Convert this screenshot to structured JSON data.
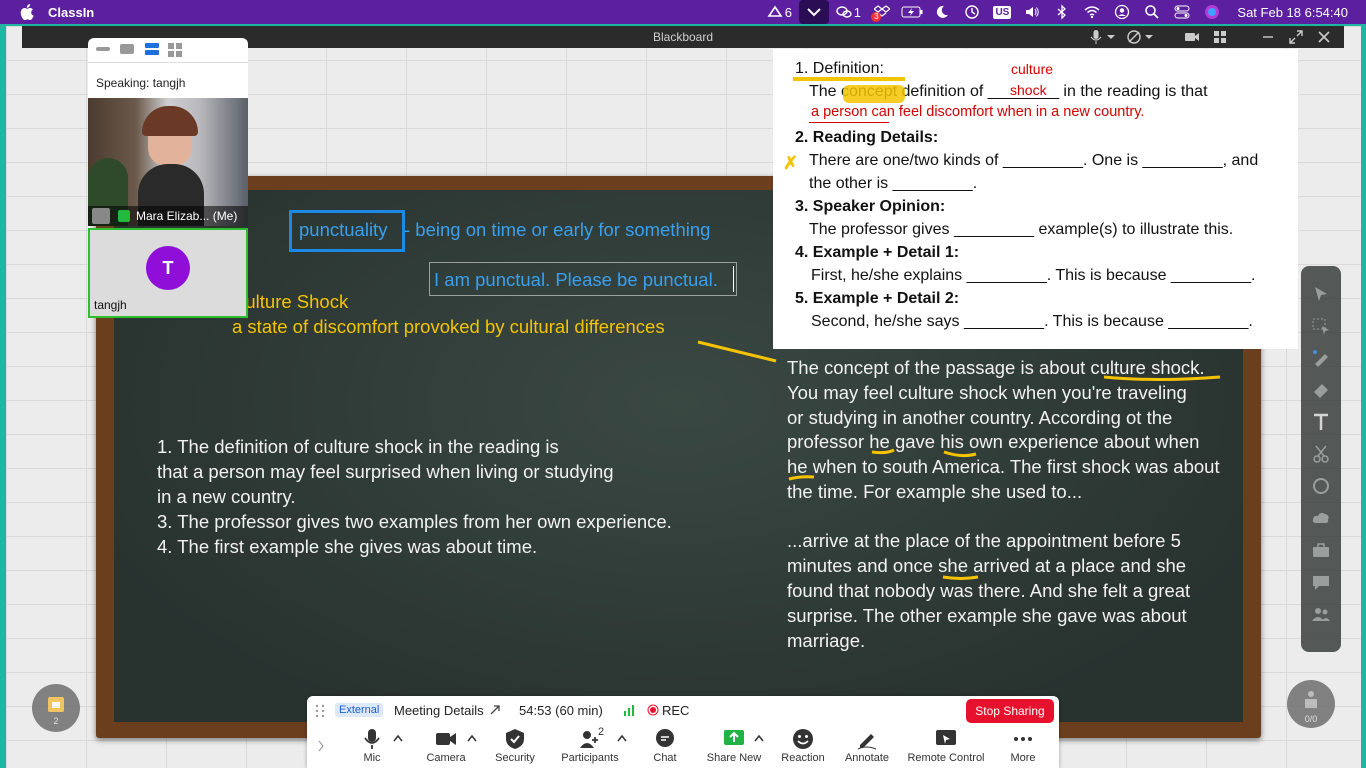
{
  "menubar": {
    "app_name": "ClassIn",
    "badge_6": "6",
    "wechat_count": "1",
    "notif_count": "3",
    "keyboard": "US",
    "datetime": "Sat Feb 18  6:54:40"
  },
  "window": {
    "title": "Blackboard"
  },
  "video_panel": {
    "speaking_label": "Speaking: tangjh",
    "host_name": "Mara Elizab... (Me)",
    "participant_initial": "T",
    "participant_name": "tangjh"
  },
  "board": {
    "vocab_word": "punctuality",
    "vocab_def": "- being on time or early for something",
    "example_sentence": "I am punctual. Please be punctual.",
    "term_title": "Culture Shock",
    "term_def": "a state of discomfort provoked by cultural differences",
    "student_notes": [
      "1. The definition of culture shock in the reading is",
      "that a person may feel surprised when living or studying",
      "in a new country.",
      "3. The professor gives two examples from her own experience.",
      "4. The first example she gives was about time."
    ],
    "teacher_notes_a": [
      "The concept of the passage is about culture shock.",
      "You may feel culture shock when you're traveling",
      "or studying in another country. According ot the",
      "professor he gave his own experience about when",
      "he when to south America. The first shock was about",
      "the time. For example she used to..."
    ],
    "teacher_notes_b": [
      "...arrive at the place of the appointment before 5",
      "minutes and once she arrived at a place and she",
      "found that nobody was there. And she felt a great",
      "surprise. The other example she gave was about",
      "marriage."
    ]
  },
  "worksheet": {
    "h1": "1. Definition:",
    "l1": "The concept definition of ________ in the reading is that",
    "ann_culture": "culture",
    "ann_shock": "shock",
    "ann_answer": "a person can feel discomfort when in a new country.",
    "h2": "2. Reading Details:",
    "l2a": "There are one/two kinds of _________. One is _________, and",
    "l2b": "the other is _________.",
    "h3": "3. Speaker Opinion:",
    "l3": "The professor gives _________ example(s) to illustrate this.",
    "h4": "4. Example + Detail 1:",
    "l4": "First, he/she explains _________. This is because _________.",
    "h5": "5. Example + Detail 2:",
    "l5": "Second, he/she says _________. This is because _________."
  },
  "zoom_bar": {
    "external": "External",
    "meeting_details": "Meeting Details",
    "timer": "54:53  (60 min)",
    "rec": "REC",
    "stop_sharing": "Stop Sharing",
    "participants_count": "2",
    "buttons": [
      "Mic",
      "Camera",
      "Security",
      "Participants",
      "Chat",
      "Share New",
      "Reaction",
      "Annotate",
      "Remote Control",
      "More"
    ]
  },
  "side_widgets": {
    "left_count": "2",
    "right_count": "0/0"
  },
  "colors": {
    "menubar": "#5b1fa0",
    "chalk_blue": "#3aa0ee",
    "chalk_yellow": "#f5c400",
    "stop_red": "#e8112d",
    "share_green": "#1fb344"
  }
}
